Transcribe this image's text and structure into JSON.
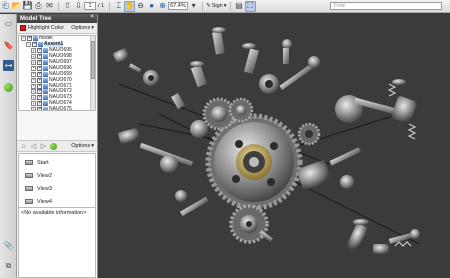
{
  "toolbar": {
    "page_current": "1",
    "page_total": "/ 1",
    "zoom": "67.4%",
    "sign_label": "Sign",
    "find_placeholder": "Find"
  },
  "model_tree": {
    "title": "Model Tree",
    "highlight_label": "Highlight Color",
    "options_label": "Options",
    "nodes": [
      {
        "label": "model",
        "level": 0,
        "selected": false
      },
      {
        "label": "Assem1",
        "level": 1,
        "selected": true
      },
      {
        "label": "NAUO695",
        "level": 2,
        "selected": false
      },
      {
        "label": "NAUO698",
        "level": 2,
        "selected": false
      },
      {
        "label": "NAUO697",
        "level": 2,
        "selected": false
      },
      {
        "label": "NAUO696",
        "level": 2,
        "selected": false
      },
      {
        "label": "NAUO699",
        "level": 2,
        "selected": false
      },
      {
        "label": "NAUO670",
        "level": 2,
        "selected": false
      },
      {
        "label": "NAUO671",
        "level": 2,
        "selected": false
      },
      {
        "label": "NAUO672",
        "level": 2,
        "selected": false
      },
      {
        "label": "NAUO673",
        "level": 2,
        "selected": false
      },
      {
        "label": "NAUO674",
        "level": 2,
        "selected": false
      },
      {
        "label": "NAUO675",
        "level": 2,
        "selected": false
      }
    ]
  },
  "views_panel": {
    "options_label": "Options",
    "items": [
      "Start",
      "View2",
      "View3",
      "View4"
    ]
  },
  "info_panel": {
    "text": "<No available information>"
  },
  "colors": {
    "canvas_bg": "#3b3b3b",
    "panel_title_bg": "#4a4a4a",
    "accent": "#2f5fa8"
  }
}
